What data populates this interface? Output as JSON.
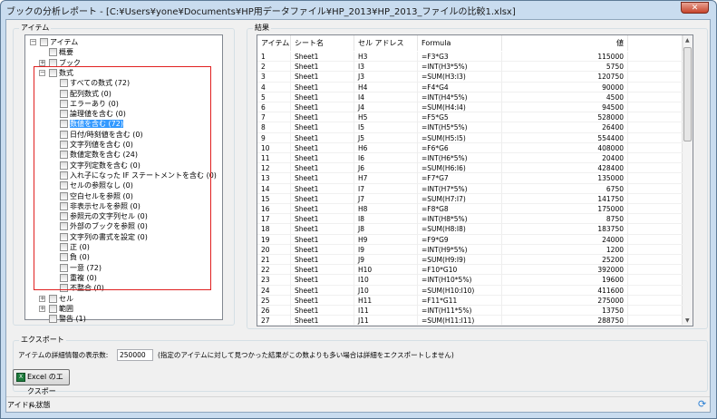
{
  "window": {
    "title": "ブックの分析レポート - [C:¥Users¥yone¥Documents¥HP用データファイル¥HP_2013¥HP_2013_ファイルの比較1.xlsx]",
    "close_icon": "close-icon"
  },
  "items_panel": {
    "label": "アイテム",
    "tree": [
      {
        "label": "アイテム",
        "level": 0,
        "expander": "minus"
      },
      {
        "label": "概要",
        "level": 1,
        "expander": "none"
      },
      {
        "label": "ブック",
        "level": 1,
        "expander": "plus"
      },
      {
        "label": "数式",
        "level": 1,
        "expander": "minus"
      },
      {
        "label": "すべての数式 (72)",
        "level": 2
      },
      {
        "label": "配列数式 (0)",
        "level": 2
      },
      {
        "label": "エラーあり (0)",
        "level": 2
      },
      {
        "label": "論理値を含む (0)",
        "level": 2
      },
      {
        "label": "数値を含む (72)",
        "level": 2,
        "selected": true
      },
      {
        "label": "日付/時刻値を含む (0)",
        "level": 2
      },
      {
        "label": "文字列値を含む (0)",
        "level": 2
      },
      {
        "label": "数値定数を含む (24)",
        "level": 2
      },
      {
        "label": "文字列定数を含む (0)",
        "level": 2
      },
      {
        "label": "入れ子になった IF ステートメントを含む (0)",
        "level": 2
      },
      {
        "label": "セルの参照なし (0)",
        "level": 2
      },
      {
        "label": "空白セルを参照 (0)",
        "level": 2
      },
      {
        "label": "非表示セルを参照 (0)",
        "level": 2
      },
      {
        "label": "参照元の文字列セル (0)",
        "level": 2
      },
      {
        "label": "外部のブックを参照 (0)",
        "level": 2
      },
      {
        "label": "文字列の書式を設定 (0)",
        "level": 2
      },
      {
        "label": "正 (0)",
        "level": 2
      },
      {
        "label": "負 (0)",
        "level": 2
      },
      {
        "label": "一意 (72)",
        "level": 2
      },
      {
        "label": "重複 (0)",
        "level": 2
      },
      {
        "label": "不整合 (0)",
        "level": 2
      },
      {
        "label": "セル",
        "level": 1,
        "expander": "plus"
      },
      {
        "label": "範囲",
        "level": 1,
        "expander": "plus"
      },
      {
        "label": "警告 (1)",
        "level": 1,
        "expander": "none"
      }
    ]
  },
  "results_panel": {
    "label": "結果",
    "columns": [
      "アイテム",
      "シート名",
      "セル アドレス",
      "Formula",
      "値"
    ],
    "rows": [
      [
        "1",
        "Sheet1",
        "H3",
        "=F3*G3",
        "115000"
      ],
      [
        "2",
        "Sheet1",
        "I3",
        "=INT(H3*5%)",
        "5750"
      ],
      [
        "3",
        "Sheet1",
        "J3",
        "=SUM(H3:I3)",
        "120750"
      ],
      [
        "4",
        "Sheet1",
        "H4",
        "=F4*G4",
        "90000"
      ],
      [
        "5",
        "Sheet1",
        "I4",
        "=INT(H4*5%)",
        "4500"
      ],
      [
        "6",
        "Sheet1",
        "J4",
        "=SUM(H4:I4)",
        "94500"
      ],
      [
        "7",
        "Sheet1",
        "H5",
        "=F5*G5",
        "528000"
      ],
      [
        "8",
        "Sheet1",
        "I5",
        "=INT(H5*5%)",
        "26400"
      ],
      [
        "9",
        "Sheet1",
        "J5",
        "=SUM(H5:I5)",
        "554400"
      ],
      [
        "10",
        "Sheet1",
        "H6",
        "=F6*G6",
        "408000"
      ],
      [
        "11",
        "Sheet1",
        "I6",
        "=INT(H6*5%)",
        "20400"
      ],
      [
        "12",
        "Sheet1",
        "J6",
        "=SUM(H6:I6)",
        "428400"
      ],
      [
        "13",
        "Sheet1",
        "H7",
        "=F7*G7",
        "135000"
      ],
      [
        "14",
        "Sheet1",
        "I7",
        "=INT(H7*5%)",
        "6750"
      ],
      [
        "15",
        "Sheet1",
        "J7",
        "=SUM(H7:I7)",
        "141750"
      ],
      [
        "16",
        "Sheet1",
        "H8",
        "=F8*G8",
        "175000"
      ],
      [
        "17",
        "Sheet1",
        "I8",
        "=INT(H8*5%)",
        "8750"
      ],
      [
        "18",
        "Sheet1",
        "J8",
        "=SUM(H8:I8)",
        "183750"
      ],
      [
        "19",
        "Sheet1",
        "H9",
        "=F9*G9",
        "24000"
      ],
      [
        "20",
        "Sheet1",
        "I9",
        "=INT(H9*5%)",
        "1200"
      ],
      [
        "21",
        "Sheet1",
        "J9",
        "=SUM(H9:I9)",
        "25200"
      ],
      [
        "22",
        "Sheet1",
        "H10",
        "=F10*G10",
        "392000"
      ],
      [
        "23",
        "Sheet1",
        "I10",
        "=INT(H10*5%)",
        "19600"
      ],
      [
        "24",
        "Sheet1",
        "J10",
        "=SUM(H10:I10)",
        "411600"
      ],
      [
        "25",
        "Sheet1",
        "H11",
        "=F11*G11",
        "275000"
      ],
      [
        "26",
        "Sheet1",
        "I11",
        "=INT(H11*5%)",
        "13750"
      ],
      [
        "27",
        "Sheet1",
        "J11",
        "=SUM(H11:I11)",
        "288750"
      ]
    ]
  },
  "export": {
    "label": "エクスポート",
    "count_label": "アイテムの詳細情報の表示数:",
    "count_value": "250000",
    "note": "(指定のアイテムに対して見つかった結果がこの数よりも多い場合は詳細をエクスポートしません)",
    "button_label": "Excel のエクスポート..."
  },
  "status": {
    "text": "アイドル状態",
    "refresh_icon": "refresh-icon"
  }
}
